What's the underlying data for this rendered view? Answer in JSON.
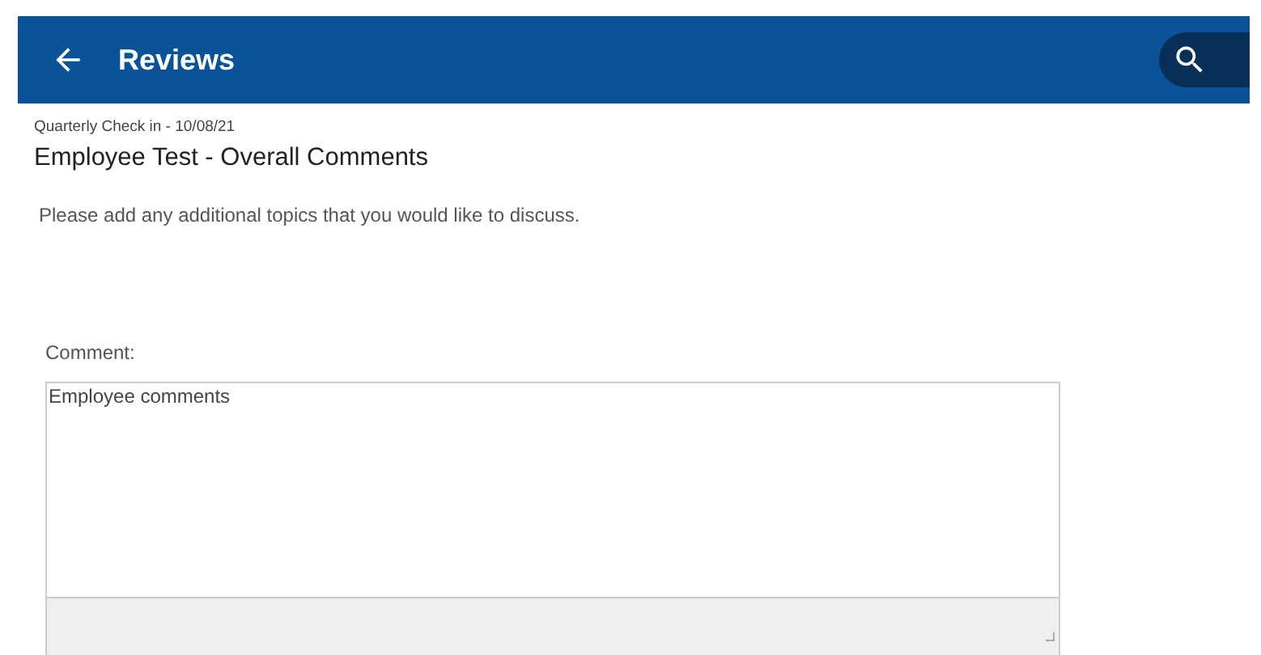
{
  "header": {
    "title": "Reviews"
  },
  "subtitle": "Quarterly Check in - 10/08/21",
  "heading": "Employee Test - Overall Comments",
  "instructions": "Please add any additional topics that you would like to discuss.",
  "comment": {
    "label": "Comment:",
    "value": "Employee comments"
  }
}
